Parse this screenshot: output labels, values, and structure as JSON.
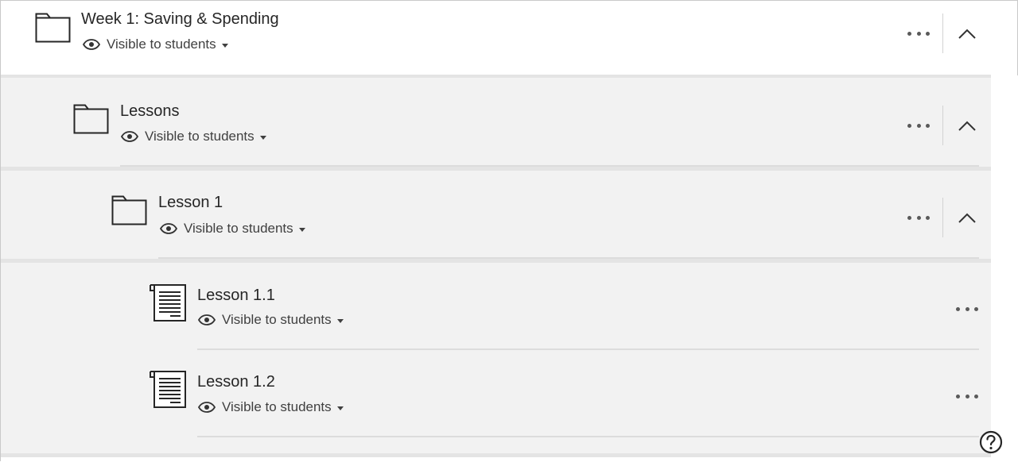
{
  "items": [
    {
      "title": "Week 1: Saving & Spending",
      "visibility": "Visible to students",
      "icon": "folder-icon"
    },
    {
      "title": "Lessons",
      "visibility": "Visible to students",
      "icon": "folder-icon"
    },
    {
      "title": "Lesson 1",
      "visibility": "Visible to students",
      "icon": "folder-icon"
    },
    {
      "title": "Lesson 1.1",
      "visibility": "Visible to students",
      "icon": "document-icon"
    },
    {
      "title": "Lesson 1.2",
      "visibility": "Visible to students",
      "icon": "document-icon"
    }
  ],
  "icons": {
    "eye": "eye-icon",
    "more": "more-options-icon",
    "collapse": "chevron-up-icon",
    "help": "help-icon"
  },
  "colors": {
    "band_background": "#f2f2f2",
    "text": "#262626"
  }
}
